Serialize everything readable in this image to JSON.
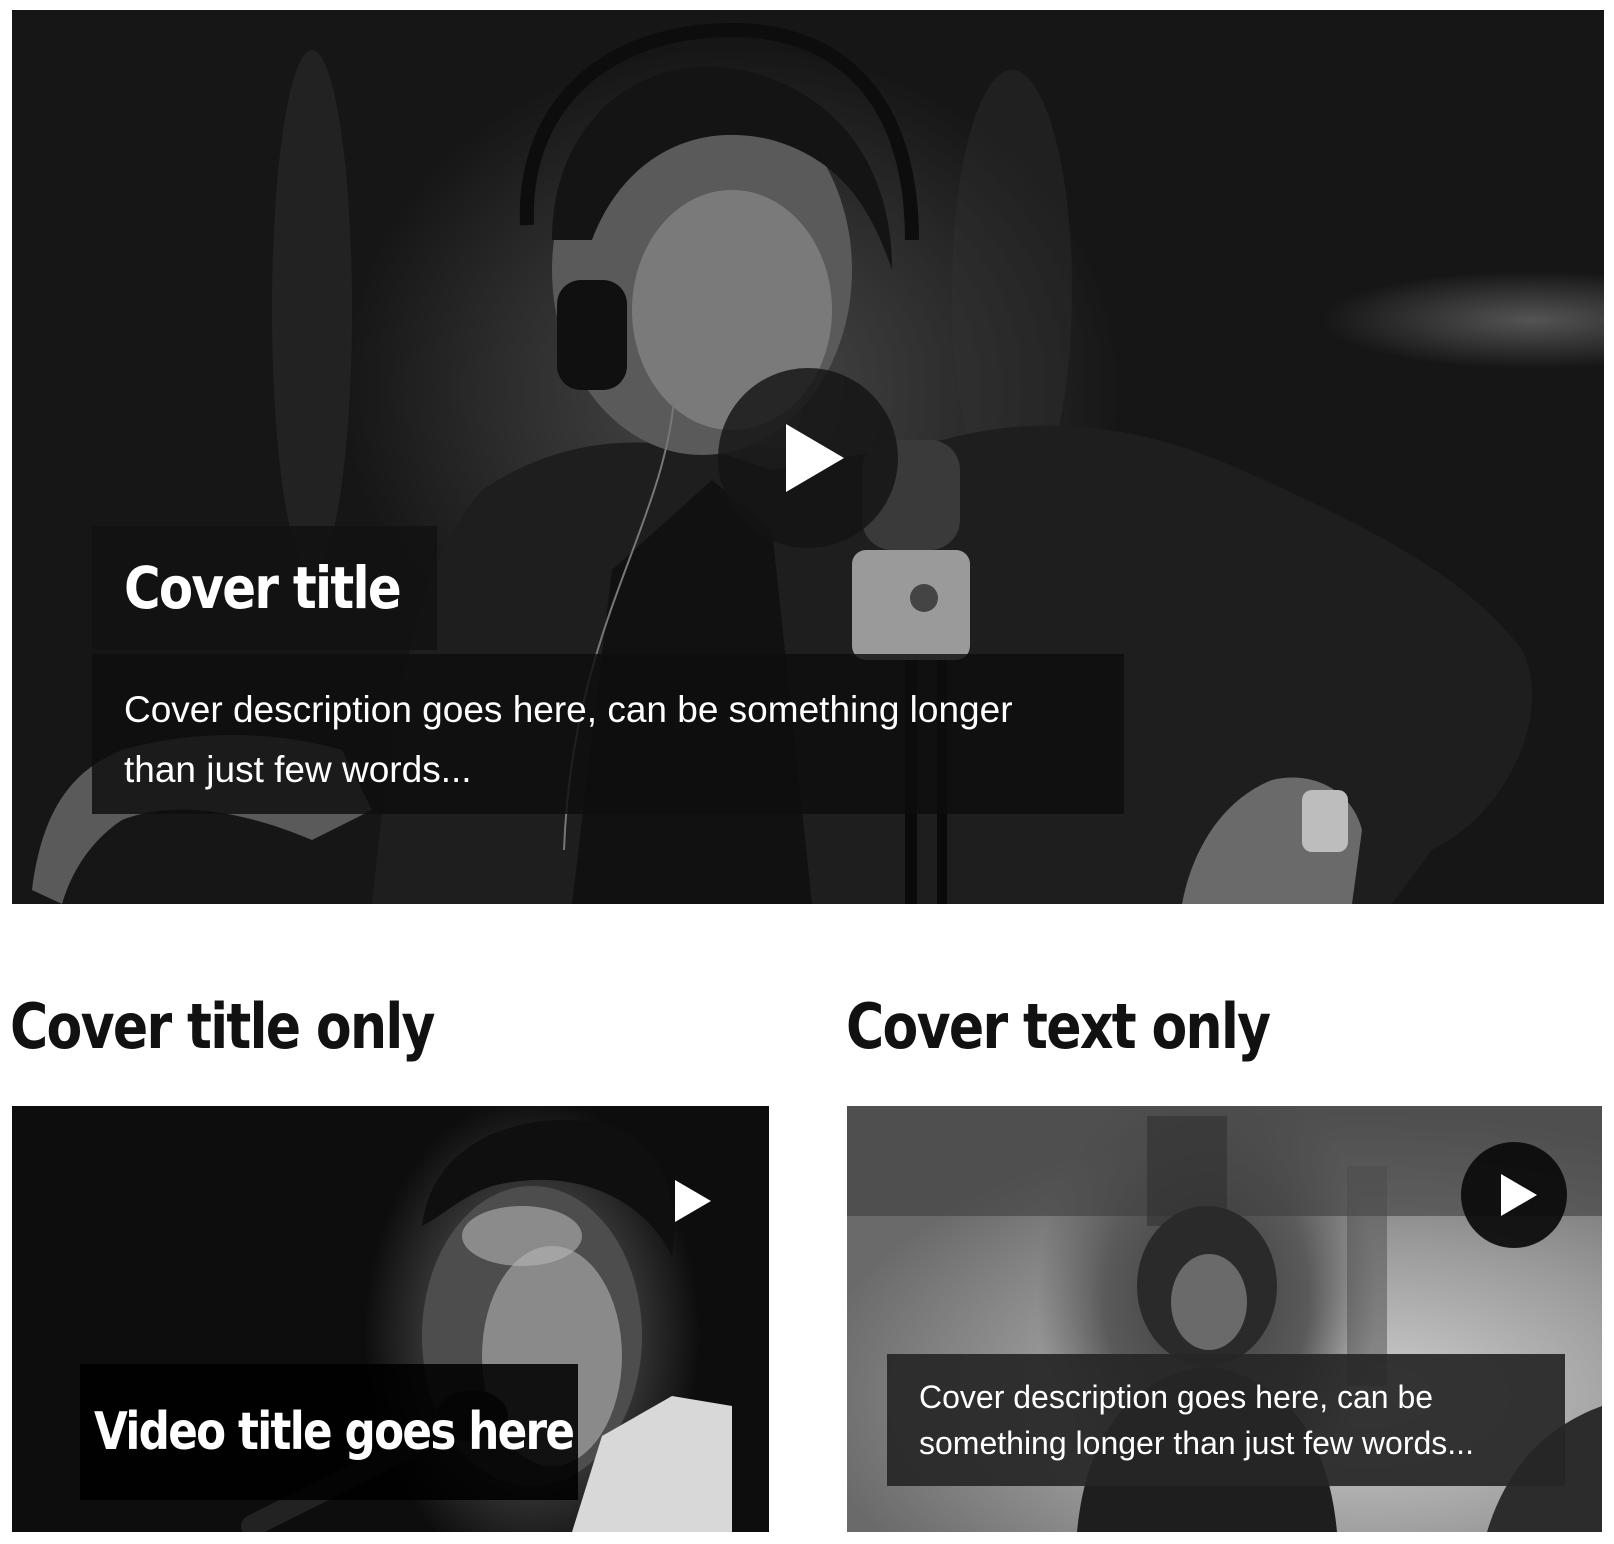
{
  "hero": {
    "title": "Cover title",
    "description": "Cover description goes here, can be something longer than just few words...",
    "play_icon": "play-icon"
  },
  "sections": {
    "left_heading": "Cover title only",
    "right_heading": "Cover text only"
  },
  "card_left": {
    "title": "Video title goes here",
    "play_icon": "play-icon"
  },
  "card_right": {
    "description": "Cover description goes here, can be something longer than just few words...",
    "play_icon": "play-icon"
  },
  "colors": {
    "overlay": "#121212",
    "text_on_overlay": "#ffffff",
    "heading_text": "#111111",
    "page_background": "#ffffff"
  }
}
